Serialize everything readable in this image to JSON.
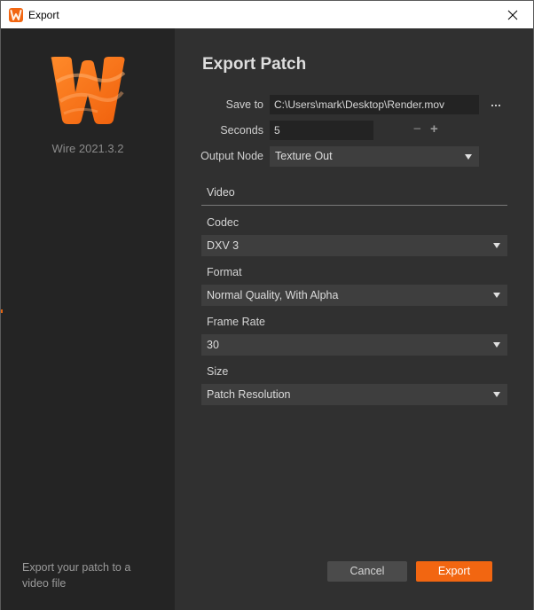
{
  "window": {
    "title": "Export"
  },
  "sidebar": {
    "version": "Wire 2021.3.2",
    "description": "Export your patch to a video file"
  },
  "main": {
    "heading": "Export Patch",
    "save_to": {
      "label": "Save to",
      "value": "C:\\Users\\mark\\Desktop\\Render.mov"
    },
    "seconds": {
      "label": "Seconds",
      "value": "5",
      "minus": "−",
      "plus": "+"
    },
    "output_node": {
      "label": "Output Node",
      "value": "Texture Out"
    },
    "video_section": {
      "title": "Video",
      "codec": {
        "label": "Codec",
        "value": "DXV 3"
      },
      "format": {
        "label": "Format",
        "value": "Normal Quality, With Alpha"
      },
      "frame_rate": {
        "label": "Frame Rate",
        "value": "30"
      },
      "size": {
        "label": "Size",
        "value": "Patch Resolution"
      }
    }
  },
  "buttons": {
    "cancel": "Cancel",
    "export": "Export"
  },
  "colors": {
    "accent": "#f26611",
    "background": "#303030",
    "sidebar": "#242424"
  }
}
